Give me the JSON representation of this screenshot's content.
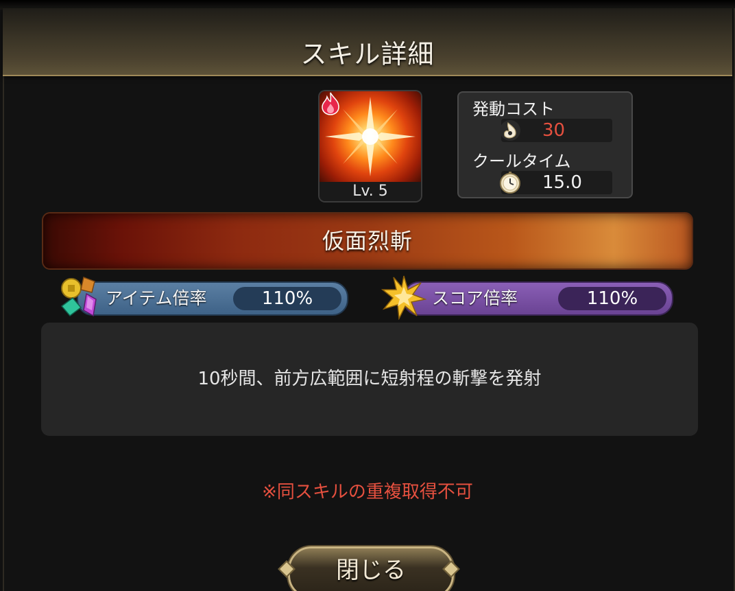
{
  "header": {
    "title": "スキル詳細"
  },
  "skill": {
    "level_label": "Lv. 5",
    "name": "仮面烈斬",
    "description": "10秒間、前方広範囲に短射程の斬撃を発射"
  },
  "stats": {
    "cost_title": "発動コスト",
    "cost_value": "30",
    "cooldown_title": "クールタイム",
    "cooldown_value": "15.0"
  },
  "multipliers": {
    "item_label": "アイテム倍率",
    "item_value": "110%",
    "score_label": "スコア倍率",
    "score_value": "110%"
  },
  "note": "※同スキルの重複取得不可",
  "close_button": {
    "label": "閉じる"
  },
  "colors": {
    "accent_gold": "#c9b482",
    "cost_value": "#e5503f",
    "note": "#e5503f",
    "item_bar": "#4a6f95",
    "score_bar": "#7a52a6"
  },
  "icons": {
    "element": "fire-icon",
    "cost": "spirit-flame-icon",
    "cooldown": "stopwatch-icon",
    "item": "treasure-gems-icon",
    "score": "star-burst-icon"
  }
}
